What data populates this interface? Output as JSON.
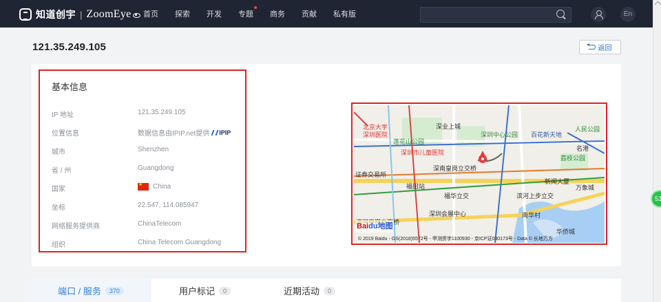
{
  "header": {
    "logo_cn": "知道创宇",
    "logo_sep": "|",
    "logo_en": "ZoomEye",
    "nav": [
      {
        "label": "首页",
        "dot": false
      },
      {
        "label": "探索",
        "dot": false
      },
      {
        "label": "开发",
        "dot": false
      },
      {
        "label": "专题",
        "dot": true
      },
      {
        "label": "商务",
        "dot": false
      },
      {
        "label": "贡献",
        "dot": false
      },
      {
        "label": "私有版",
        "dot": false
      }
    ],
    "search_placeholder": "",
    "lang": "En"
  },
  "page": {
    "ip": "121.35.249.105",
    "back_label": "返回"
  },
  "info": {
    "title": "基本信息",
    "rows": [
      {
        "label": "IP 地址",
        "value": "121.35.249.105"
      },
      {
        "label": "位置信息",
        "value": "数据信息由IPIP.net提供",
        "extra": "IPIP"
      },
      {
        "label": "城市",
        "value": "Shenzhen"
      },
      {
        "label": "省 / 州",
        "value": "Guangdong"
      },
      {
        "label": "国家",
        "value": "China"
      },
      {
        "label": "坐标",
        "value": "22.547, 114.085947"
      },
      {
        "label": "网络服务提供商",
        "value": "ChinaTelecom"
      },
      {
        "label": "组织",
        "value": "China Telecom Guangdong"
      }
    ]
  },
  "map": {
    "labels": [
      {
        "text": "北京大学",
        "cls": "red"
      },
      {
        "text": "深圳医院",
        "cls": "red"
      },
      {
        "text": "深业上城",
        "cls": ""
      },
      {
        "text": "莲花山公园",
        "cls": "green"
      },
      {
        "text": "深圳中心公园",
        "cls": "green"
      },
      {
        "text": "百花新天地",
        "cls": "blue"
      },
      {
        "text": "人民公园",
        "cls": "green"
      },
      {
        "text": "深圳市儿童医院",
        "cls": "red"
      },
      {
        "text": "名港",
        "cls": ""
      },
      {
        "text": "荔枝公园",
        "cls": "green"
      },
      {
        "text": "深南皇岗立交桥",
        "cls": ""
      },
      {
        "text": "证券交易所",
        "cls": ""
      },
      {
        "text": "福田站",
        "cls": ""
      },
      {
        "text": "新闻大厦",
        "cls": ""
      },
      {
        "text": "万象城",
        "cls": ""
      },
      {
        "text": "福华立交",
        "cls": ""
      },
      {
        "text": "滨河上步立交",
        "cls": ""
      },
      {
        "text": "深圳会展中心",
        "cls": ""
      },
      {
        "text": "南华村",
        "cls": ""
      },
      {
        "text": "滨河皇岗立交桥",
        "cls": ""
      },
      {
        "text": "华侨城",
        "cls": ""
      }
    ],
    "baidu_logo": "Bai",
    "baidu_logo_b": "du地图",
    "copyright": "© 2019 Baidu - GS(2018)5572号 - 甲测资字1100930 - 京ICP证030173号 - Data © 长地万方"
  },
  "tabs": [
    {
      "label": "端口 / 服务",
      "count": "370",
      "active": true
    },
    {
      "label": "用户标记",
      "count": "0",
      "active": false
    },
    {
      "label": "近期活动",
      "count": "0",
      "active": false
    }
  ],
  "float_badge": "53"
}
